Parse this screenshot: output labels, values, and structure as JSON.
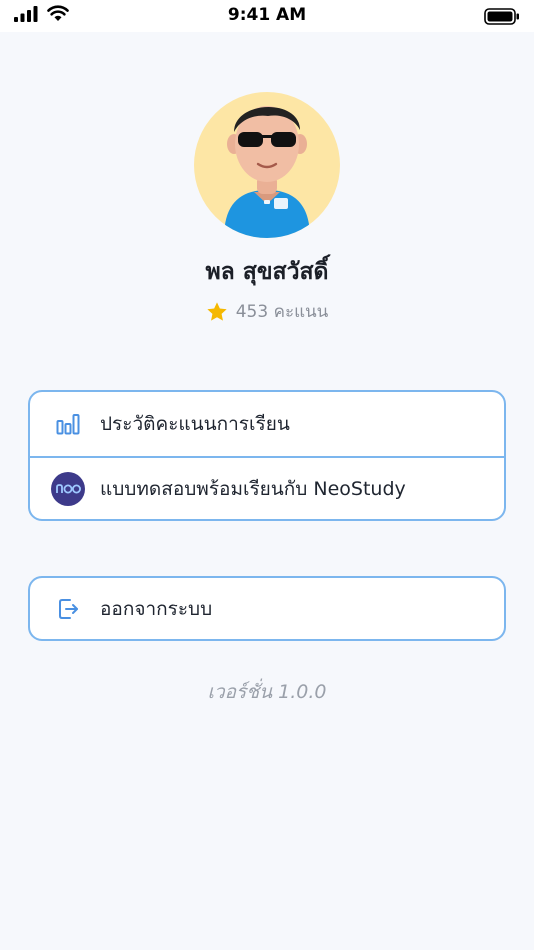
{
  "status_bar": {
    "time": "9:41 AM",
    "icons": [
      "signal-icon",
      "wifi-icon",
      "battery-icon"
    ]
  },
  "profile": {
    "avatar_icon": "avatar-3d-character",
    "name": "พล สุขสวัสดิ์",
    "score_icon": "star-icon",
    "score_text": "453 คะแนน"
  },
  "menu": {
    "items": [
      {
        "label": "ประวัติคะแนนการเรียน",
        "icon": "bar-chart-icon"
      },
      {
        "label": "แบบทดสอบพร้อมเรียนกับ NeoStudy",
        "icon": "neostudy-logo-icon"
      }
    ]
  },
  "logout": {
    "label": "ออกจากระบบ",
    "icon": "logout-icon"
  },
  "version_text": "เวอร์ชั่น 1.0.0",
  "colors": {
    "accent": "#4a90e2",
    "card_border": "#7cb6ee",
    "star": "#f5b800",
    "neo_badge": "#3d3a8a",
    "avatar_bg": "#fde6a5"
  }
}
